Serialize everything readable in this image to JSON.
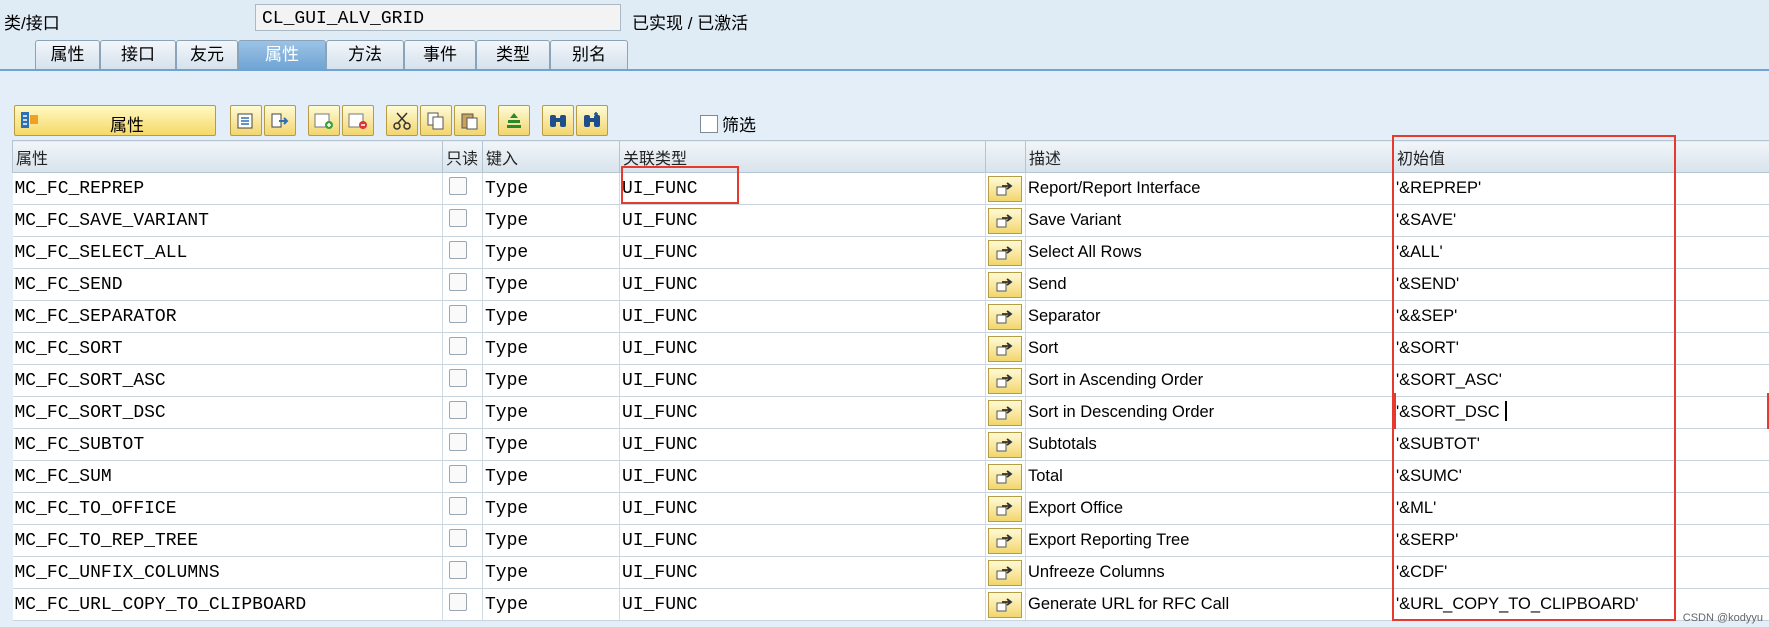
{
  "header": {
    "class_label": "类/接口",
    "class_name": "CL_GUI_ALV_GRID",
    "status": "已实现 / 已激活"
  },
  "tabs": [
    {
      "label": "属性",
      "active": false
    },
    {
      "label": "接口",
      "active": false
    },
    {
      "label": "友元",
      "active": false
    },
    {
      "label": "属性",
      "active": true
    },
    {
      "label": "方法",
      "active": false
    },
    {
      "label": "事件",
      "active": false
    },
    {
      "label": "类型",
      "active": false
    },
    {
      "label": "别名",
      "active": false
    }
  ],
  "toolbar": {
    "attributes_button": "属性",
    "filter_label": "筛选",
    "icons": [
      "detail-view-icon",
      "navigate-icon",
      "insert-row-icon",
      "delete-row-icon",
      "cut-icon",
      "copy-icon",
      "paste-icon",
      "sort-icon",
      "find-icon",
      "find-next-icon"
    ]
  },
  "table": {
    "columns": [
      "属性",
      "只读",
      "键入",
      "关联类型",
      "",
      "描述",
      "初始值"
    ],
    "rows": [
      {
        "name": "MC_FC_REPREP",
        "typing": "Type",
        "type": "UI_FUNC",
        "desc": "Report/Report Interface",
        "init": "'&REPREP'"
      },
      {
        "name": "MC_FC_SAVE_VARIANT",
        "typing": "Type",
        "type": "UI_FUNC",
        "desc": "Save Variant",
        "init": "'&SAVE'"
      },
      {
        "name": "MC_FC_SELECT_ALL",
        "typing": "Type",
        "type": "UI_FUNC",
        "desc": "Select All Rows",
        "init": "'&ALL'"
      },
      {
        "name": "MC_FC_SEND",
        "typing": "Type",
        "type": "UI_FUNC",
        "desc": "Send",
        "init": "'&SEND'"
      },
      {
        "name": "MC_FC_SEPARATOR",
        "typing": "Type",
        "type": "UI_FUNC",
        "desc": "Separator",
        "init": "'&&SEP'"
      },
      {
        "name": "MC_FC_SORT",
        "typing": "Type",
        "type": "UI_FUNC",
        "desc": "Sort",
        "init": "'&SORT'"
      },
      {
        "name": "MC_FC_SORT_ASC",
        "typing": "Type",
        "type": "UI_FUNC",
        "desc": "Sort in Ascending Order",
        "init": "'&SORT_ASC'"
      },
      {
        "name": "MC_FC_SORT_DSC",
        "typing": "Type",
        "type": "UI_FUNC",
        "desc": "Sort in Descending Order",
        "init": "'&SORT_DSC"
      },
      {
        "name": "MC_FC_SUBTOT",
        "typing": "Type",
        "type": "UI_FUNC",
        "desc": "Subtotals",
        "init": "'&SUBTOT'"
      },
      {
        "name": "MC_FC_SUM",
        "typing": "Type",
        "type": "UI_FUNC",
        "desc": "Total",
        "init": "'&SUMC'"
      },
      {
        "name": "MC_FC_TO_OFFICE",
        "typing": "Type",
        "type": "UI_FUNC",
        "desc": "Export Office",
        "init": "'&ML'"
      },
      {
        "name": "MC_FC_TO_REP_TREE",
        "typing": "Type",
        "type": "UI_FUNC",
        "desc": "Export Reporting Tree",
        "init": "'&SERP'"
      },
      {
        "name": "MC_FC_UNFIX_COLUMNS",
        "typing": "Type",
        "type": "UI_FUNC",
        "desc": "Unfreeze Columns",
        "init": "'&CDF'"
      },
      {
        "name": "MC_FC_URL_COPY_TO_CLIPBOARD",
        "typing": "Type",
        "type": "UI_FUNC",
        "desc": "Generate URL for RFC Call",
        "init": "'&URL_COPY_TO_CLIPBOARD'"
      }
    ]
  },
  "footer": {
    "watermark": "CSDN @kodyyu"
  },
  "colors": {
    "highlight": "#e53a2d",
    "active_tab": "#6ea3d3",
    "button_yellow": "#f5d868"
  }
}
